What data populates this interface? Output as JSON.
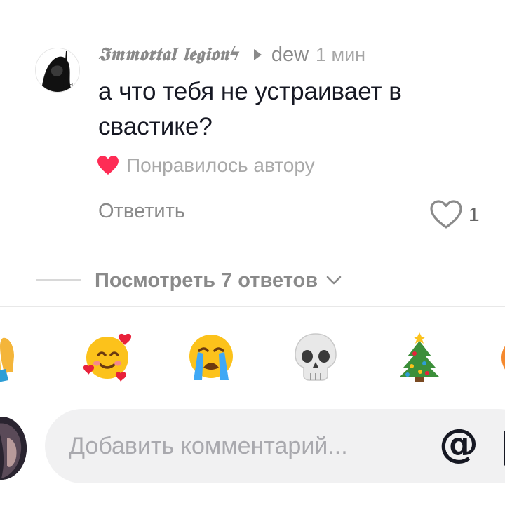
{
  "comment": {
    "username": "𝕴𝖒𝖒𝖔𝖗𝖙𝖆𝖑 𝖑𝖊𝖌𝖎𝖔𝖓ϟ",
    "reply_target": "dew",
    "time_ago": "1 мин",
    "text": "а что тебя не устраивает в свастике?",
    "liked_by_author_label": "Понравилось автору",
    "reply_label": "Ответить",
    "like_count": "1",
    "view_replies_label": "Посмотреть 7 ответов"
  },
  "quick_emojis": [
    "folded-hands",
    "smiling-face-with-hearts",
    "loudly-crying-face",
    "skull",
    "christmas-tree",
    "partial-emoji"
  ],
  "input": {
    "placeholder": "Добавить комментарий...",
    "mention_symbol": "@"
  },
  "colors": {
    "liked_heart": "#fe2c55",
    "muted_text": "#8a8a8a",
    "primary_text": "#161823",
    "input_background": "#f1f1f2"
  }
}
